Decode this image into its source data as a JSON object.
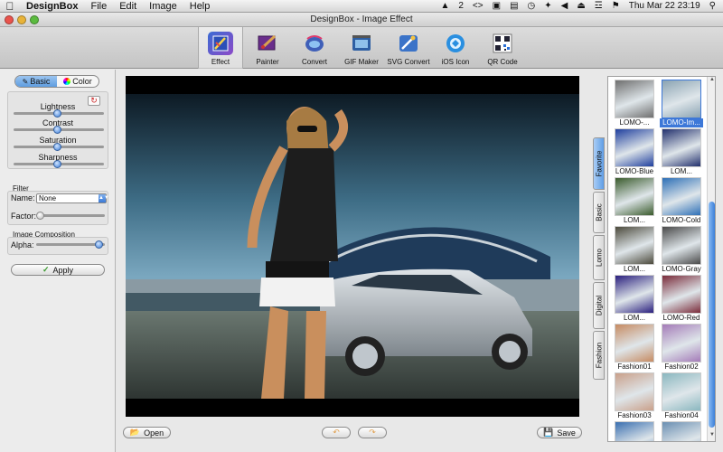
{
  "menubar": {
    "apple": "",
    "app_name": "DesignBox",
    "items": [
      "File",
      "Edit",
      "Image",
      "Help"
    ],
    "status": {
      "indicator": "2",
      "clock": "Thu Mar 22  23:19"
    }
  },
  "window": {
    "title": "DesignBox - Image Effect"
  },
  "toolbar": {
    "tools": [
      {
        "label": "Effect",
        "icon": "effect-icon",
        "active": true
      },
      {
        "label": "Painter",
        "icon": "painter-icon",
        "active": false
      },
      {
        "label": "Convert",
        "icon": "convert-icon",
        "active": false
      },
      {
        "label": "GIF Maker",
        "icon": "gif-maker-icon",
        "active": false
      },
      {
        "label": "SVG Convert",
        "icon": "svg-convert-icon",
        "active": false
      },
      {
        "label": "iOS Icon",
        "icon": "ios-icon-icon",
        "active": false
      },
      {
        "label": "QR Code",
        "icon": "qr-code-icon",
        "active": false
      }
    ]
  },
  "left": {
    "tabs": {
      "basic": "Basic",
      "color": "Color"
    },
    "sliders": [
      {
        "label": "Lightness",
        "value": 0.5
      },
      {
        "label": "Contrast",
        "value": 0.5
      },
      {
        "label": "Saturation",
        "value": 0.5
      },
      {
        "label": "Sharpness",
        "value": 0.5
      }
    ],
    "filter": {
      "section": "Filter",
      "name_label": "Name:",
      "name_value": "None",
      "factor_label": "Factor:",
      "factor_value": 0.0
    },
    "composition": {
      "section": "Image Composition",
      "alpha_label": "Alpha:",
      "alpha_value": 1.0
    },
    "apply_label": "Apply"
  },
  "bottom": {
    "open_label": "Open",
    "save_label": "Save"
  },
  "right": {
    "tabs": [
      "Favorite",
      "Basic",
      "Lomo",
      "Digital",
      "Fashion"
    ],
    "active_tab": "Favorite",
    "thumbnails": [
      {
        "label": "LOMO-...",
        "selected": false,
        "tone": "#6f6f6f"
      },
      {
        "label": "LOMO-Im...",
        "selected": true,
        "tone": "#8aa3b2"
      },
      {
        "label": "LOMO-Blue",
        "selected": false,
        "tone": "#1f3f9e"
      },
      {
        "label": "LOM...",
        "selected": false,
        "tone": "#22306d"
      },
      {
        "label": "LOM...",
        "selected": false,
        "tone": "#3a5b2c"
      },
      {
        "label": "LOMO-Cold",
        "selected": false,
        "tone": "#2d6fb6"
      },
      {
        "label": "LOM...",
        "selected": false,
        "tone": "#4c4a3c"
      },
      {
        "label": "LOMO-Gray",
        "selected": false,
        "tone": "#4a4a4a"
      },
      {
        "label": "LOM...",
        "selected": false,
        "tone": "#2a1f7e"
      },
      {
        "label": "LOMO-Red",
        "selected": false,
        "tone": "#7a2b3a"
      },
      {
        "label": "Fashion01",
        "selected": false,
        "tone": "#c68b62"
      },
      {
        "label": "Fashion02",
        "selected": false,
        "tone": "#a47bb8"
      },
      {
        "label": "Fashion03",
        "selected": false,
        "tone": "#c9a08a"
      },
      {
        "label": "Fashion04",
        "selected": false,
        "tone": "#8ab7bf"
      },
      {
        "label": "",
        "selected": false,
        "tone": "#3a6fb0"
      },
      {
        "label": "",
        "selected": false,
        "tone": "#6a8fb2"
      }
    ]
  },
  "colors": {
    "accent": "#3d78d8",
    "selection": "#3d78d8"
  }
}
